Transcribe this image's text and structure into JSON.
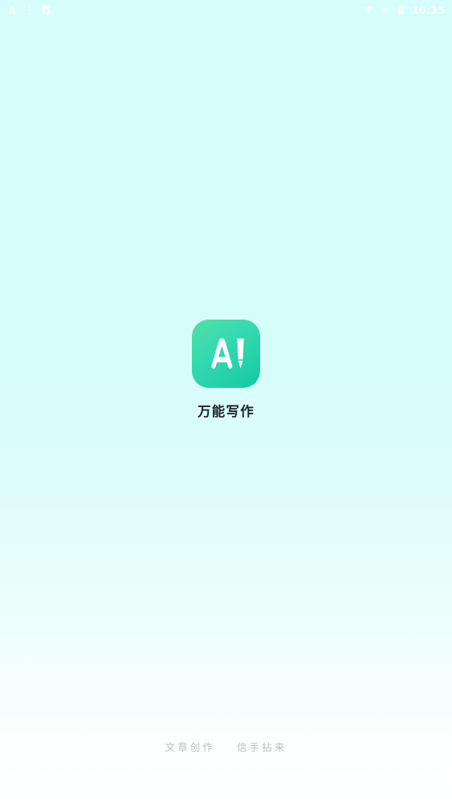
{
  "app": {
    "name": "万能写作",
    "icon_letters": "A!",
    "icon_name": "ai-pen-icon",
    "icon_gradient_start": "#4FE0A8",
    "icon_gradient_mid": "#35D9B0",
    "icon_gradient_end": "#13C9A1"
  },
  "status_bar": {
    "time": "10:35",
    "left_icons": [
      {
        "name": "warning-triangle-icon",
        "glyph": "warning"
      },
      {
        "name": "download-icon",
        "glyph": "download"
      },
      {
        "name": "app-badge-icon",
        "glyph": "badge"
      }
    ],
    "right_icons": [
      {
        "name": "wifi-icon",
        "glyph": "wifi"
      },
      {
        "name": "signal-dot-icon",
        "glyph": "dot"
      },
      {
        "name": "battery-icon",
        "glyph": "battery"
      }
    ]
  },
  "tagline": {
    "part_one": "文章创作",
    "part_two": "信手拈来"
  },
  "theme": {
    "background_top": "#D6FDFB",
    "background_bottom": "#FFFFFF",
    "app_name_color": "#20242B",
    "tagline_color": "#B9BFC2"
  }
}
